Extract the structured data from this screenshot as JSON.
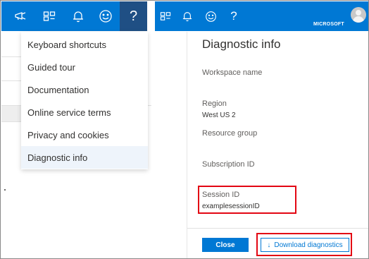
{
  "menu": {
    "items": [
      {
        "label": "Keyboard shortcuts"
      },
      {
        "label": "Guided tour"
      },
      {
        "label": "Documentation"
      },
      {
        "label": "Online service terms"
      },
      {
        "label": "Privacy and cookies"
      },
      {
        "label": "Diagnostic info",
        "selected": true
      }
    ]
  },
  "topbar": {
    "help_glyph": "?",
    "brand": "MICROSOFT",
    "icons_left": [
      "announcement-icon",
      "cloud-shell-icon",
      "notifications-bell-icon",
      "feedback-smiley-icon",
      "help-icon"
    ],
    "icons_right": [
      "cloud-shell-icon",
      "notifications-bell-icon",
      "feedback-smiley-icon",
      "help-icon",
      "avatar"
    ]
  },
  "panel": {
    "title": "Diagnostic info",
    "workspace_label": "Workspace name",
    "workspace_value": "",
    "region_label": "Region",
    "region_value": "West US 2",
    "resource_group_label": "Resource group",
    "resource_group_value": "",
    "subscription_label": "Subscription ID",
    "subscription_value": "",
    "session_label": "Session ID",
    "session_value": "examplesessionID",
    "close_label": "Close",
    "download_label": "Download diagnostics"
  },
  "colors": {
    "accent": "#0078d4",
    "header_active": "#1f4f84",
    "highlight_box": "#e30613",
    "selected_item_bg": "#eef4fb"
  }
}
